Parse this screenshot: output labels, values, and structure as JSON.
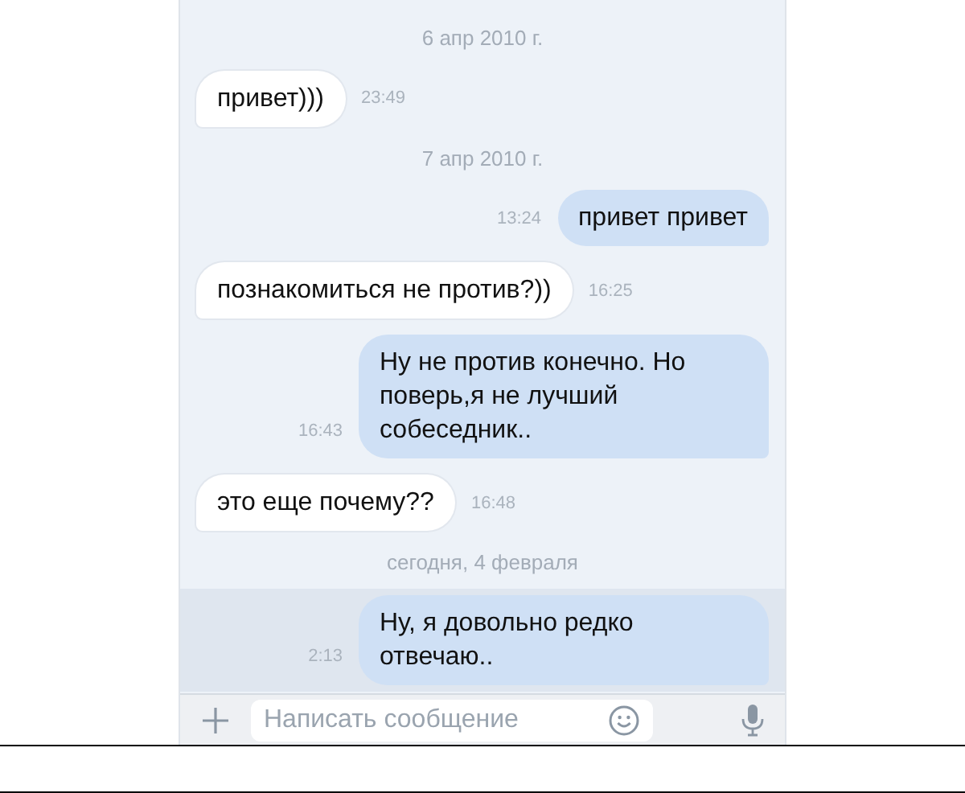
{
  "messages": [
    {
      "kind": "date",
      "text": "6 апр 2010 г."
    },
    {
      "kind": "incoming",
      "text": "привет)))",
      "time": "23:49",
      "unread": false
    },
    {
      "kind": "date",
      "text": "7 апр 2010 г."
    },
    {
      "kind": "outgoing",
      "text": "привет привет",
      "time": "13:24",
      "unread": false
    },
    {
      "kind": "incoming",
      "text": "познакомиться не против?))",
      "time": "16:25",
      "unread": false
    },
    {
      "kind": "outgoing",
      "text": "Ну не против конечно. Но поверь,я не лучший собеседник..",
      "time": "16:43",
      "unread": false
    },
    {
      "kind": "incoming",
      "text": "это еще почему??",
      "time": "16:48",
      "unread": false
    },
    {
      "kind": "date",
      "text": "сегодня, 4 февраля"
    },
    {
      "kind": "outgoing",
      "text": "Ну, я довольно редко отвечаю..",
      "time": "2:13",
      "unread": true
    }
  ],
  "composer": {
    "placeholder": "Написать сообщение"
  }
}
